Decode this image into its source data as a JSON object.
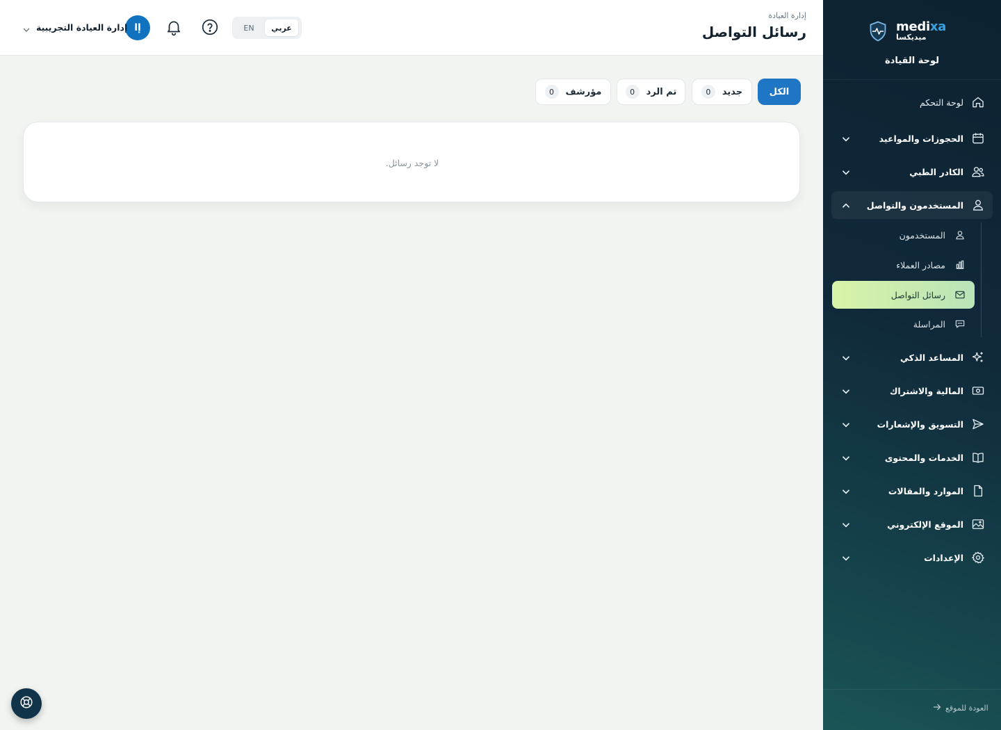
{
  "header": {
    "breadcrumb": "إدارة العيادة",
    "title": "رسائل التواصل",
    "lang_ar": "عربي",
    "lang_en": "EN",
    "user_name": "إدارة العيادة التجريبية",
    "avatar_initial": "إا"
  },
  "filters": [
    {
      "label": "الكل",
      "active": true
    },
    {
      "label": "جديد",
      "count": "0"
    },
    {
      "label": "تم الرد",
      "count": "0"
    },
    {
      "label": "مؤرشف",
      "count": "0"
    }
  ],
  "content": {
    "empty_message": "لا توجد رسائل."
  },
  "sidebar": {
    "brand_name_en": "medi",
    "brand_name_en_accent": "xa",
    "brand_name_ar": "ميديكسا",
    "title": "لوحة القيادة",
    "items": [
      {
        "label": "لوحة التحكم",
        "icon": "home-icon"
      },
      {
        "label": "الحجوزات والمواعيد",
        "icon": "calendar-icon"
      },
      {
        "label": "الكادر الطبي",
        "icon": "users-icon"
      },
      {
        "label": "المستخدمون والتواصل",
        "icon": "user-icon"
      },
      {
        "label": "المساعد الذكي",
        "icon": "sparkles-icon"
      },
      {
        "label": "المالية والاشتراك",
        "icon": "money-icon"
      },
      {
        "label": "التسويق والإشعارات",
        "icon": "send-icon"
      },
      {
        "label": "الخدمات والمحتوى",
        "icon": "book-icon"
      },
      {
        "label": "الموارد والمقالات",
        "icon": "file-icon"
      },
      {
        "label": "الموقع الإلكتروني",
        "icon": "image-icon"
      },
      {
        "label": "الإعدادات",
        "icon": "gear-icon"
      }
    ],
    "sub_items": [
      {
        "label": "المستخدمون",
        "icon": "user-icon"
      },
      {
        "label": "مصادر العملاء",
        "icon": "bar-chart-icon"
      },
      {
        "label": "رسائل التواصل",
        "icon": "mail-icon",
        "active": true
      },
      {
        "label": "المراسلة",
        "icon": "chat-icon"
      }
    ],
    "back_link": "العودة للموقع"
  },
  "colors": {
    "primary": "#1e76c4",
    "sidebar_bg": "#10293a",
    "active_sub_item": "#cdeeb0"
  }
}
